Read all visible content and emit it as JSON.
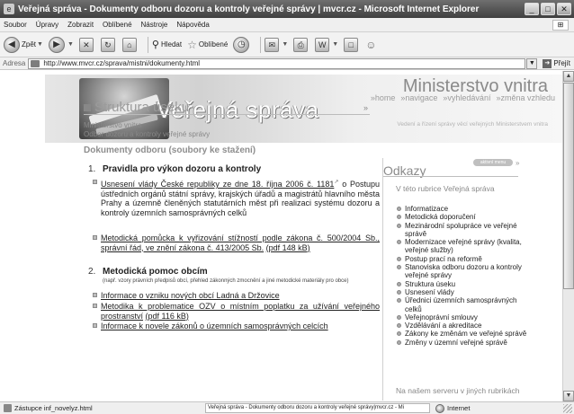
{
  "window": {
    "title": "Veřejná správa - Dokumenty odboru dozoru a kontroly veřejné správy | mvcr.cz - Microsoft Internet Explorer"
  },
  "menubar": {
    "items": [
      "Soubor",
      "Úpravy",
      "Zobrazit",
      "Oblíbené",
      "Nástroje",
      "Nápověda"
    ]
  },
  "toolbar": {
    "back_label": "Zpět",
    "search_label": "Hledat",
    "favorites_label": "Oblíbené"
  },
  "address": {
    "label": "Adresa",
    "url": "http://www.mvcr.cz/sprava/mistni/dokumenty.html",
    "go_label": "Přejít"
  },
  "banner": {
    "title": "Veřejná správa",
    "ministry": "Ministerstvo vnitra",
    "nav": [
      "»home",
      "»navigace",
      "»vyhledávání",
      "»změna vzhledu"
    ],
    "tagline": "Vedení a řízení správy věcí veřejných Ministerstvem vnitra"
  },
  "section": {
    "title": "Struktura úseku",
    "breadcrumb_line1": "Ministerstvo vnitra",
    "breadcrumb_line2": "Odbor dozoru a kontroly veřejné správy",
    "subtitle": "Dokumenty odboru (soubory ke stažení)"
  },
  "list": [
    {
      "number": "1.",
      "heading": "Pravidla pro výkon dozoru a kontroly",
      "items": [
        {
          "link": "Usnesení vlády České republiky ze dne 18. října 2006 č. 1181",
          "rest": "o Postupu ústředních orgánů státní správy, krajských úřadů a magistrátů hlavního města Prahy a územně členěných statutárních měst při realizaci systému dozoru a kontroly územních samosprávných celků"
        },
        {
          "link": "Metodická pomůcka k vyřizování stížností podle zákona č. 500/2004 Sb., správní řád, ve znění zákona č. 413/2005 Sb.",
          "size": "(pdf 148 kB)"
        }
      ]
    },
    {
      "number": "2.",
      "heading": "Metodická pomoc obcím",
      "note": "(např. vzory právních předpisů obcí, přehled zákonných zmocnění a jiné metodické materiály pro obce)",
      "items": [
        {
          "link": "Informace o vzniku nových obcí Ladná a Držovice"
        },
        {
          "link": "Metodika k problematice OZV o místním poplatku za užívání veřejného prostranství",
          "size": "(pdf 116 kB)"
        },
        {
          "link": "Informace k novele zákonů o územních samosprávných celcích"
        }
      ]
    }
  ],
  "sidebar": {
    "title": "Odkazy",
    "menu_badge": "aktivní menu",
    "intro": "V této rubrice Veřejná správa",
    "items": [
      "Informatizace",
      "Metodická doporučení",
      "Mezinárodní spolupráce ve veřejné správě",
      "Modernizace veřejné správy (kvalita, veřejné služby)",
      "Postup prací na reformě",
      "Stanoviska odboru dozoru a kontroly veřejné správy",
      "Struktura úseku",
      "Usnesení vlády",
      "Úřednici územních samosprávných celků",
      "Veřejnoprávní smlouvy",
      "Vzdělávání a akreditace",
      "Zákony ke změnám ve veřejné správě",
      "Změny v územní veřejné správě"
    ],
    "footer": "Na našem serveru v jiných rubrikách"
  },
  "status": {
    "left": "Zástupce inf_novelyz.html",
    "middle": "Veřejná správa - Dokumenty odboru dozoru a kontroly veřejné správy|mvcr.cz - Mi",
    "zone": "Internet"
  }
}
